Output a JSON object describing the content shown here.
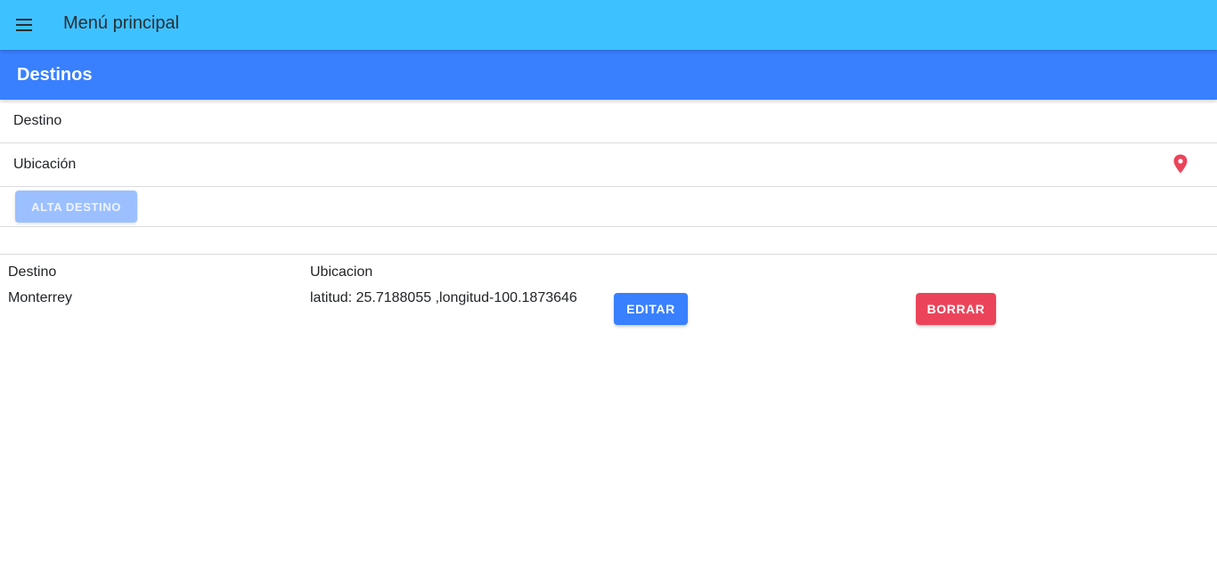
{
  "toolbar": {
    "menu_icon": "menu-icon",
    "title": "Menú principal",
    "color": "#3dc2ff"
  },
  "subheader": {
    "title": "Destinos",
    "color": "#3880ff"
  },
  "form": {
    "destino_label": "Destino",
    "destino_value": "",
    "ubicacion_label": "Ubicación",
    "ubicacion_value": "",
    "location_icon": "location-pin-icon",
    "location_icon_color": "#eb445a",
    "submit_label": "ALTA DESTINO",
    "submit_disabled": true
  },
  "table": {
    "headers": [
      "Destino",
      "Ubicacion"
    ],
    "rows": [
      {
        "destino": "Monterrey",
        "ubicacion": "latitud: 25.7188055 ,longitud-100.1873646",
        "edit_label": "EDITAR",
        "delete_label": "BORRAR"
      }
    ]
  },
  "colors": {
    "primary": "#3880ff",
    "danger": "#eb445a",
    "secondary": "#3dc2ff"
  }
}
